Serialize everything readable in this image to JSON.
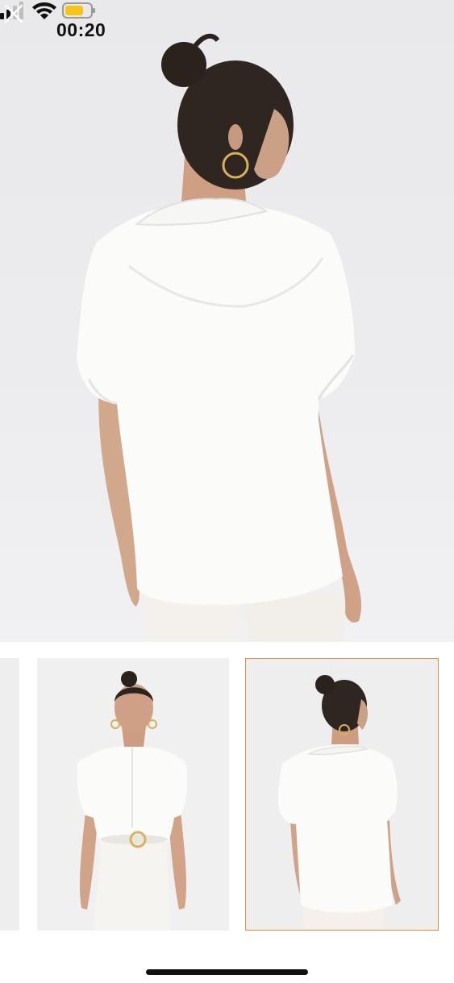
{
  "status_bar": {
    "time": "00:20",
    "icons": [
      "signal-icon",
      "wifi-icon",
      "battery-icon"
    ],
    "battery_color": "#f5c518"
  },
  "viewer": {
    "close_icon": "close-icon",
    "main_image": "model-back-view-white-blouse"
  },
  "thumbnails": [
    {
      "image": "partial-previous-photo",
      "selected": false
    },
    {
      "image": "model-front-view-white-blouse",
      "selected": false
    },
    {
      "image": "model-back-view-white-blouse",
      "selected": true
    }
  ],
  "colors": {
    "selected_border": "#e08a43",
    "background": "#ffffff"
  }
}
